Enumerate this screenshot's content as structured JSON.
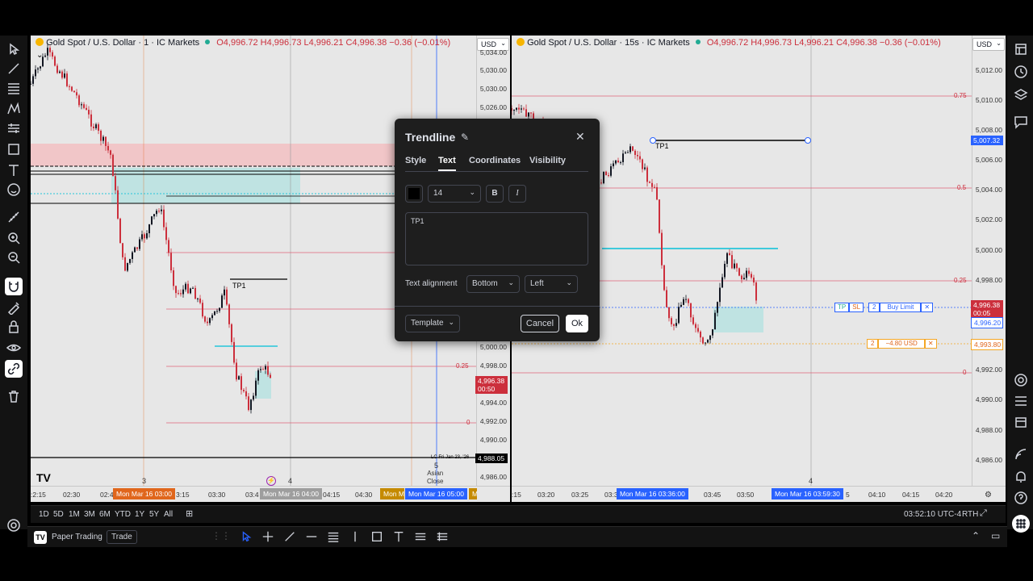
{
  "left_chart": {
    "title": "Gold Spot / U.S. Dollar · 1 · IC Markets",
    "ohlc": "O4,996.72 H4,996.73 L4,996.21 C4,996.38 −0.36 (−0.01%)",
    "currency": "USD",
    "price_labels": [
      "5,030.00",
      "5,026.00",
      "5,000.00",
      "4,998.00",
      "4,994.00",
      "4,992.00",
      "4,990.00",
      "4,986.00"
    ],
    "top_price": "5,034.00",
    "current_price": "4,996.38",
    "countdown": "00:50",
    "low_label": "4,988.05",
    "lc_label": "LC Fri Jan 23, '26",
    "fib_025": "0.25",
    "fib_0": "0",
    "tp_label": "TP1",
    "day_3": "3",
    "day_4": "4",
    "day_5": "5",
    "asian_close": "Asian\nClose",
    "time_labels": [
      ":2:15",
      "02:30",
      "02:4",
      "3:15",
      "03:30",
      "03:4",
      "04:15",
      "04:30"
    ],
    "time_highlight_1": "Mon Mar 16   03:00",
    "time_highlight_2": "Mon Mar 16   04:00",
    "time_highlight_3": "Mon Mar 16   05:00",
    "time_partial_1": "Mon Ma",
    "time_partial_2": "M"
  },
  "right_chart": {
    "title": "Gold Spot / U.S. Dollar · 15s · IC Markets",
    "ohlc": "O4,996.72 H4,996.73 L4,996.21 C4,996.38 −0.36 (−0.01%)",
    "currency": "USD",
    "price_labels": [
      "5,012.00",
      "5,010.00",
      "5,008.00",
      "5,006.00",
      "5,004.00",
      "5,002.00",
      "5,000.00",
      "4,998.00",
      "4,992.00",
      "4,990.00",
      "4,988.00",
      "4,986.00"
    ],
    "tp_price": "5,007.32",
    "current_price": "4,996.38",
    "countdown": "00:05",
    "order_price": "4,996.20",
    "sl_price": "4,993.80",
    "fib_075": "0.75",
    "fib_05": "0.5",
    "fib_025": "0.25",
    "fib_0": "0",
    "tp_label": "TP1",
    "order_tp": "TP",
    "order_sl": "SL",
    "order_qty": "2",
    "order_type": "Buy Limit",
    "order_close": "✕",
    "pos_qty": "2",
    "pos_pnl": "−4.80 USD",
    "pos_close": "✕",
    "day_4": "4",
    "time_labels": [
      ":15",
      "03:20",
      "03:25",
      "03:3",
      "03:45",
      "03:50",
      "04:10",
      "04:15",
      "04:20"
    ],
    "time_highlight_1": "Mon Mar 16   03:36:00",
    "time_highlight_2": "Mon Mar 16   03:59:30",
    "time_partial": "5"
  },
  "range_bar": {
    "ranges": [
      "1D",
      "5D",
      "1M",
      "3M",
      "6M",
      "YTD",
      "1Y",
      "5Y",
      "All"
    ],
    "clock": "03:52:10 UTC-4",
    "rth": "RTH"
  },
  "bottom_bar": {
    "paper_trading": "Paper Trading",
    "trade": "Trade"
  },
  "dialog": {
    "title": "Trendline",
    "tabs": [
      "Style",
      "Text",
      "Coordinates",
      "Visibility"
    ],
    "font_size": "14",
    "bold": "B",
    "italic": "I",
    "text_value": "TP1",
    "alignment_label": "Text alignment",
    "vertical_align": "Bottom",
    "horizontal_align": "Left",
    "template": "Template",
    "cancel": "Cancel",
    "ok": "Ok",
    "close": "✕"
  },
  "colors": {
    "bull": "#131722",
    "bear": "#cc2f3c",
    "fib": "#e0637a",
    "cyan": "#26c6da",
    "accent_blue": "#2962ff",
    "orange": "#e0661c"
  }
}
